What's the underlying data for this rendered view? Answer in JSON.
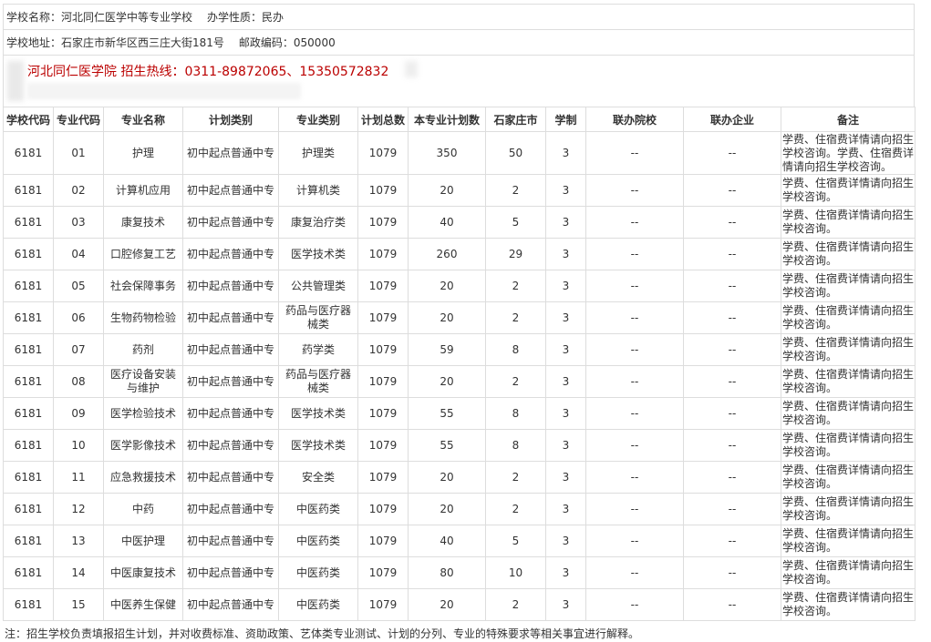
{
  "info": {
    "school_name": "学校名称：河北同仁医学中等专业学校",
    "school_type": "办学性质：民办",
    "address": "学校地址：石家庄市新华区西三庄大街181号",
    "postcode": "邮政编码：050000",
    "hotline": "河北同仁医学院 招生热线：0311-89872065、15350572832"
  },
  "columns": [
    "学校代码",
    "专业代码",
    "专业名称",
    "计划类别",
    "专业类别",
    "计划总数",
    "本专业计划数",
    "石家庄市",
    "学制",
    "联办院校",
    "联办企业",
    "备注"
  ],
  "rows": [
    {
      "school": "6181",
      "code": "01",
      "name": "护理",
      "plan": "初中起点普通中专",
      "category": "护理类",
      "total": "1079",
      "count": "350",
      "sjz": "50",
      "years": "3",
      "school2": "--",
      "company": "--",
      "note": "学费、住宿费详情请向招生学校咨询。学费、住宿费详情请向招生学校咨询。"
    },
    {
      "school": "6181",
      "code": "02",
      "name": "计算机应用",
      "plan": "初中起点普通中专",
      "category": "计算机类",
      "total": "1079",
      "count": "20",
      "sjz": "2",
      "years": "3",
      "school2": "--",
      "company": "--",
      "note": "学费、住宿费详情请向招生学校咨询。"
    },
    {
      "school": "6181",
      "code": "03",
      "name": "康复技术",
      "plan": "初中起点普通中专",
      "category": "康复治疗类",
      "total": "1079",
      "count": "40",
      "sjz": "5",
      "years": "3",
      "school2": "--",
      "company": "--",
      "note": "学费、住宿费详情请向招生学校咨询。"
    },
    {
      "school": "6181",
      "code": "04",
      "name": "口腔修复工艺",
      "plan": "初中起点普通中专",
      "category": "医学技术类",
      "total": "1079",
      "count": "260",
      "sjz": "29",
      "years": "3",
      "school2": "--",
      "company": "--",
      "note": "学费、住宿费详情请向招生学校咨询。"
    },
    {
      "school": "6181",
      "code": "05",
      "name": "社会保障事务",
      "plan": "初中起点普通中专",
      "category": "公共管理类",
      "total": "1079",
      "count": "20",
      "sjz": "2",
      "years": "3",
      "school2": "--",
      "company": "--",
      "note": "学费、住宿费详情请向招生学校咨询。"
    },
    {
      "school": "6181",
      "code": "06",
      "name": "生物药物检验",
      "plan": "初中起点普通中专",
      "category": "药品与医疗器械类",
      "total": "1079",
      "count": "20",
      "sjz": "2",
      "years": "3",
      "school2": "--",
      "company": "--",
      "note": "学费、住宿费详情请向招生学校咨询。"
    },
    {
      "school": "6181",
      "code": "07",
      "name": "药剂",
      "plan": "初中起点普通中专",
      "category": "药学类",
      "total": "1079",
      "count": "59",
      "sjz": "8",
      "years": "3",
      "school2": "--",
      "company": "--",
      "note": "学费、住宿费详情请向招生学校咨询。"
    },
    {
      "school": "6181",
      "code": "08",
      "name": "医疗设备安装与维护",
      "plan": "初中起点普通中专",
      "category": "药品与医疗器械类",
      "total": "1079",
      "count": "20",
      "sjz": "2",
      "years": "3",
      "school2": "--",
      "company": "--",
      "note": "学费、住宿费详情请向招生学校咨询。"
    },
    {
      "school": "6181",
      "code": "09",
      "name": "医学检验技术",
      "plan": "初中起点普通中专",
      "category": "医学技术类",
      "total": "1079",
      "count": "55",
      "sjz": "8",
      "years": "3",
      "school2": "--",
      "company": "--",
      "note": "学费、住宿费详情请向招生学校咨询。"
    },
    {
      "school": "6181",
      "code": "10",
      "name": "医学影像技术",
      "plan": "初中起点普通中专",
      "category": "医学技术类",
      "total": "1079",
      "count": "55",
      "sjz": "8",
      "years": "3",
      "school2": "--",
      "company": "--",
      "note": "学费、住宿费详情请向招生学校咨询。"
    },
    {
      "school": "6181",
      "code": "11",
      "name": "应急救援技术",
      "plan": "初中起点普通中专",
      "category": "安全类",
      "total": "1079",
      "count": "20",
      "sjz": "2",
      "years": "3",
      "school2": "--",
      "company": "--",
      "note": "学费、住宿费详情请向招生学校咨询。"
    },
    {
      "school": "6181",
      "code": "12",
      "name": "中药",
      "plan": "初中起点普通中专",
      "category": "中医药类",
      "total": "1079",
      "count": "20",
      "sjz": "2",
      "years": "3",
      "school2": "--",
      "company": "--",
      "note": "学费、住宿费详情请向招生学校咨询。"
    },
    {
      "school": "6181",
      "code": "13",
      "name": "中医护理",
      "plan": "初中起点普通中专",
      "category": "中医药类",
      "total": "1079",
      "count": "40",
      "sjz": "5",
      "years": "3",
      "school2": "--",
      "company": "--",
      "note": "学费、住宿费详情请向招生学校咨询。"
    },
    {
      "school": "6181",
      "code": "14",
      "name": "中医康复技术",
      "plan": "初中起点普通中专",
      "category": "中医药类",
      "total": "1079",
      "count": "80",
      "sjz": "10",
      "years": "3",
      "school2": "--",
      "company": "--",
      "note": "学费、住宿费详情请向招生学校咨询。"
    },
    {
      "school": "6181",
      "code": "15",
      "name": "中医养生保健",
      "plan": "初中起点普通中专",
      "category": "中医药类",
      "total": "1079",
      "count": "20",
      "sjz": "2",
      "years": "3",
      "school2": "--",
      "company": "--",
      "note": "学费、住宿费详情请向招生学校咨询。"
    }
  ],
  "footer": "注：招生学校负责填报招生计划，并对收费标准、资助政策、艺体类专业测试、计划的分列、专业的特殊要求等相关事宜进行解释。"
}
